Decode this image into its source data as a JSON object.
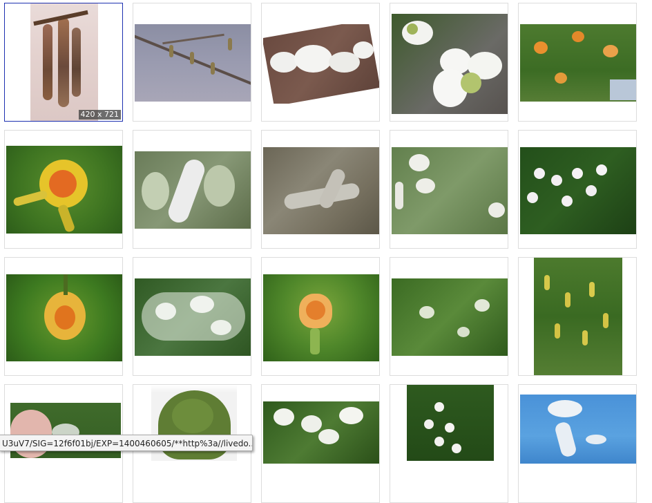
{
  "results": {
    "selected_size_badge": "420 x 721",
    "thumbnails": [
      {
        "subject": "hanging catkins"
      },
      {
        "subject": "branches with buds"
      },
      {
        "subject": "cotton fluff on pavement"
      },
      {
        "subject": "white dogwood flower"
      },
      {
        "subject": "orange tulip tree flowers"
      },
      {
        "subject": "yellow tulip tree flower"
      },
      {
        "subject": "white catkin among leaves"
      },
      {
        "subject": "cotton on ground"
      },
      {
        "subject": "white blossoms on tree"
      },
      {
        "subject": "white flower clusters"
      },
      {
        "subject": "tulip tree flower close-up"
      },
      {
        "subject": "fringe tree white blossoms"
      },
      {
        "subject": "tulip tree bud"
      },
      {
        "subject": "green leafy tree"
      },
      {
        "subject": "tree with yellow catkins"
      },
      {
        "subject": "hand holding fluff"
      },
      {
        "subject": "large tree crown"
      },
      {
        "subject": "white flowers and leaves"
      },
      {
        "subject": "white flower spikes"
      },
      {
        "subject": "fluff against blue sky"
      }
    ]
  },
  "status_bar": {
    "url_text": "U3uV7/SIG=12f6f01bj/EXP=1400460605/**http%3a//livedo..."
  }
}
